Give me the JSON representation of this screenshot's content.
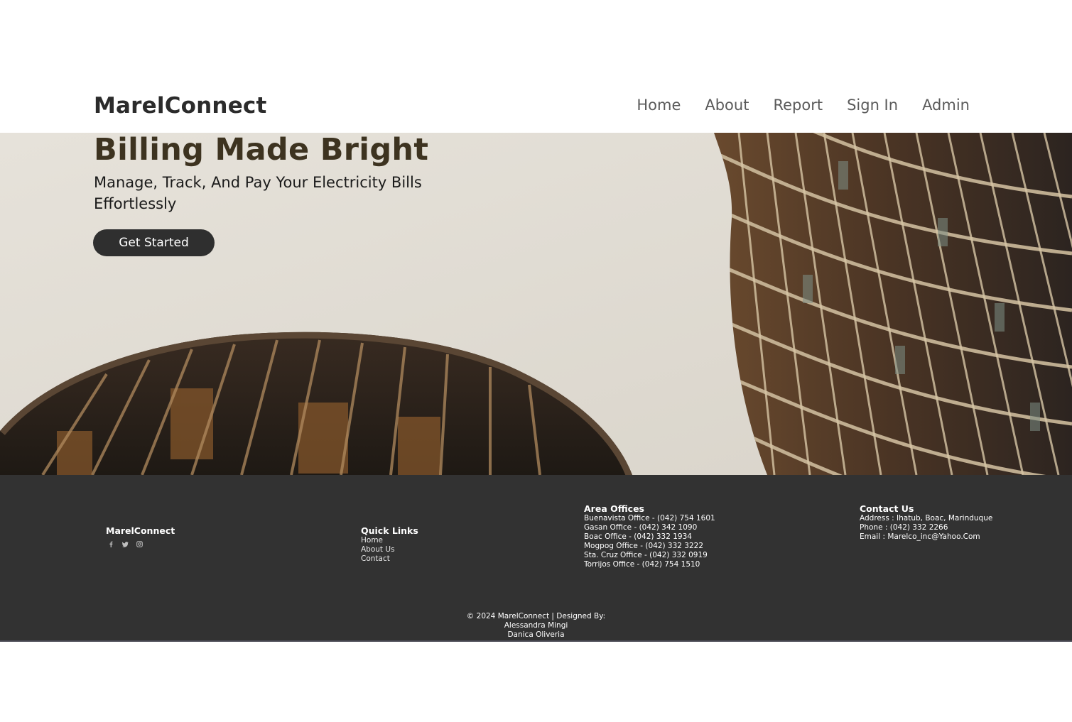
{
  "navbar": {
    "brand": "MarelConnect",
    "links": [
      "Home",
      "About",
      "Report",
      "Sign In",
      "Admin"
    ]
  },
  "hero": {
    "title": "Billing Made Bright",
    "subtitle": "Manage, Track, And Pay Your Electricity Bills Effortlessly",
    "cta_label": "Get Started"
  },
  "footer": {
    "brand": "MarelConnect",
    "social_icons": [
      "facebook-icon",
      "twitter-icon",
      "instagram-icon"
    ],
    "quick_links": {
      "heading": "Quick Links",
      "items": [
        "Home",
        "About Us",
        "Contact"
      ]
    },
    "area_offices": {
      "heading": "Area Offices",
      "items": [
        "Buenavista Office - (042) 754 1601",
        "Gasan Office - (042) 342 1090",
        "Boac Office - (042) 332 1934",
        "Mogpog Office - (042) 332 3222",
        "Sta. Cruz Office - (042) 332 0919",
        "Torrijos Office - (042) 754 1510"
      ]
    },
    "contact": {
      "heading": "Contact Us",
      "address": "Address : Ihatub, Boac, Marinduque",
      "phone": "Phone : (042) 332 2266",
      "email": "Email : Marelco_inc@Yahoo.Com"
    },
    "copyright": "© 2024 MarelConnect | Designed By:",
    "designers": [
      "Alessandra Mingi",
      "Danica Oliveria"
    ]
  },
  "colors": {
    "footer_bg": "#323232",
    "hero_title": "#3d3320",
    "button_bg": "#2f2f2f"
  }
}
